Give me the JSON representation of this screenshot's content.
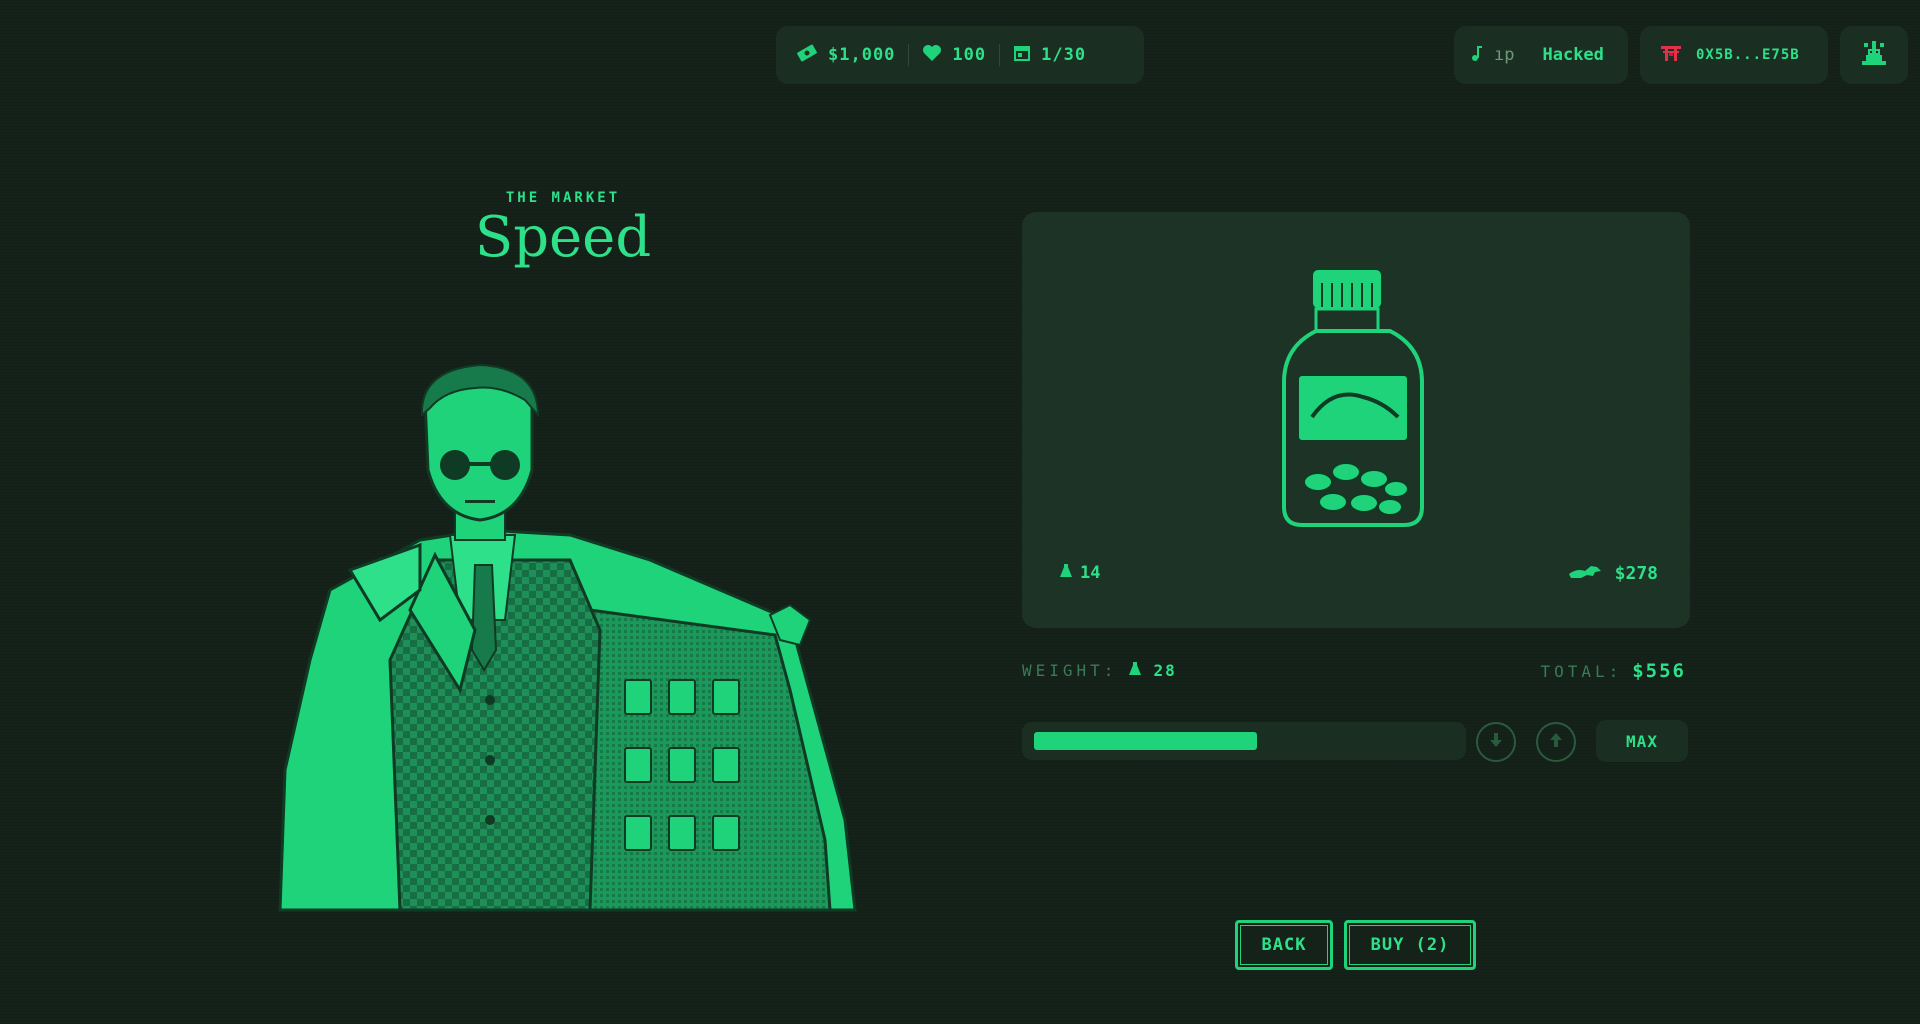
{
  "header": {
    "cash": "$1,000",
    "health": "100",
    "day": "1/30",
    "music_track": "ıp",
    "music_status": "Hacked",
    "wallet": "0X5B...E75B"
  },
  "market": {
    "eyebrow": "THE MARKET",
    "title": "Speed"
  },
  "product": {
    "unit_weight": "14",
    "unit_price": "$278"
  },
  "trade": {
    "weight_label": "WEIGHT:",
    "weight_value": "28",
    "total_label": "TOTAL:",
    "total_value": "$556",
    "quantity_fraction": 0.53,
    "max_label": "MAX"
  },
  "actions": {
    "back_label": "BACK",
    "buy_label": "BUY (2)"
  },
  "colors": {
    "background": "#15221a",
    "accent": "#1fd37a",
    "panel": "#1b2e22",
    "wallet_icon": "#e0304a"
  },
  "icons": [
    "cash-icon",
    "heart-icon",
    "calendar-icon",
    "music-note-icon",
    "wallet-torii-icon",
    "avatar-icon",
    "weight-icon",
    "rabbit-price-icon",
    "arrow-down-icon",
    "arrow-up-icon"
  ]
}
